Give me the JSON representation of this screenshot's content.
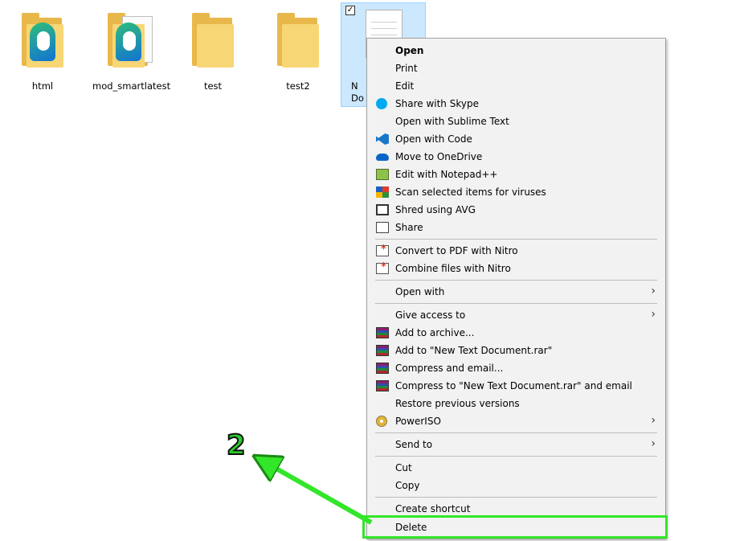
{
  "desktop": {
    "items": [
      {
        "label": "html",
        "icon": "folder-edge-icon"
      },
      {
        "label": "mod_smartlatest",
        "icon": "folder-edge-doc-icon"
      },
      {
        "label": "test",
        "icon": "folder-icon"
      },
      {
        "label": "test2",
        "icon": "folder-icon"
      }
    ],
    "selected_file": {
      "label": "N\nDo",
      "icon": "text-document-icon",
      "checkbox": "✓"
    }
  },
  "context_menu": {
    "items": [
      {
        "label": "Open",
        "bold": true
      },
      {
        "label": "Print"
      },
      {
        "label": "Edit"
      },
      {
        "label": "Share with Skype",
        "icon": "skype-icon"
      },
      {
        "label": "Open with Sublime Text"
      },
      {
        "label": "Open with Code",
        "icon": "vscode-icon"
      },
      {
        "label": "Move to OneDrive",
        "icon": "onedrive-icon"
      },
      {
        "label": "Edit with Notepad++",
        "icon": "notepadpp-icon"
      },
      {
        "label": "Scan selected items for viruses",
        "icon": "avg-icon"
      },
      {
        "label": "Shred using AVG",
        "icon": "shredder-icon"
      },
      {
        "label": "Share",
        "icon": "share-icon"
      },
      {
        "label": "Convert to PDF with Nitro",
        "icon": "nitro-icon"
      },
      {
        "label": "Combine files with Nitro",
        "icon": "nitro-combine-icon"
      },
      {
        "label": "Open with",
        "submenu": true
      },
      {
        "label": "Give access to",
        "submenu": true
      },
      {
        "label": "Add to archive...",
        "icon": "winrar-icon"
      },
      {
        "label": "Add to \"New Text Document.rar\"",
        "icon": "winrar-icon"
      },
      {
        "label": "Compress and email...",
        "icon": "winrar-icon"
      },
      {
        "label": "Compress to \"New Text Document.rar\" and email",
        "icon": "winrar-icon"
      },
      {
        "label": "Restore previous versions"
      },
      {
        "label": "PowerISO",
        "icon": "poweriso-icon",
        "submenu": true
      },
      {
        "label": "Send to",
        "submenu": true
      },
      {
        "label": "Cut"
      },
      {
        "label": "Copy"
      },
      {
        "label": "Create shortcut"
      },
      {
        "label": "Delete"
      }
    ],
    "submenu_arrow": "›"
  },
  "annotation": {
    "step_number": "2",
    "color": "#33e62a"
  }
}
